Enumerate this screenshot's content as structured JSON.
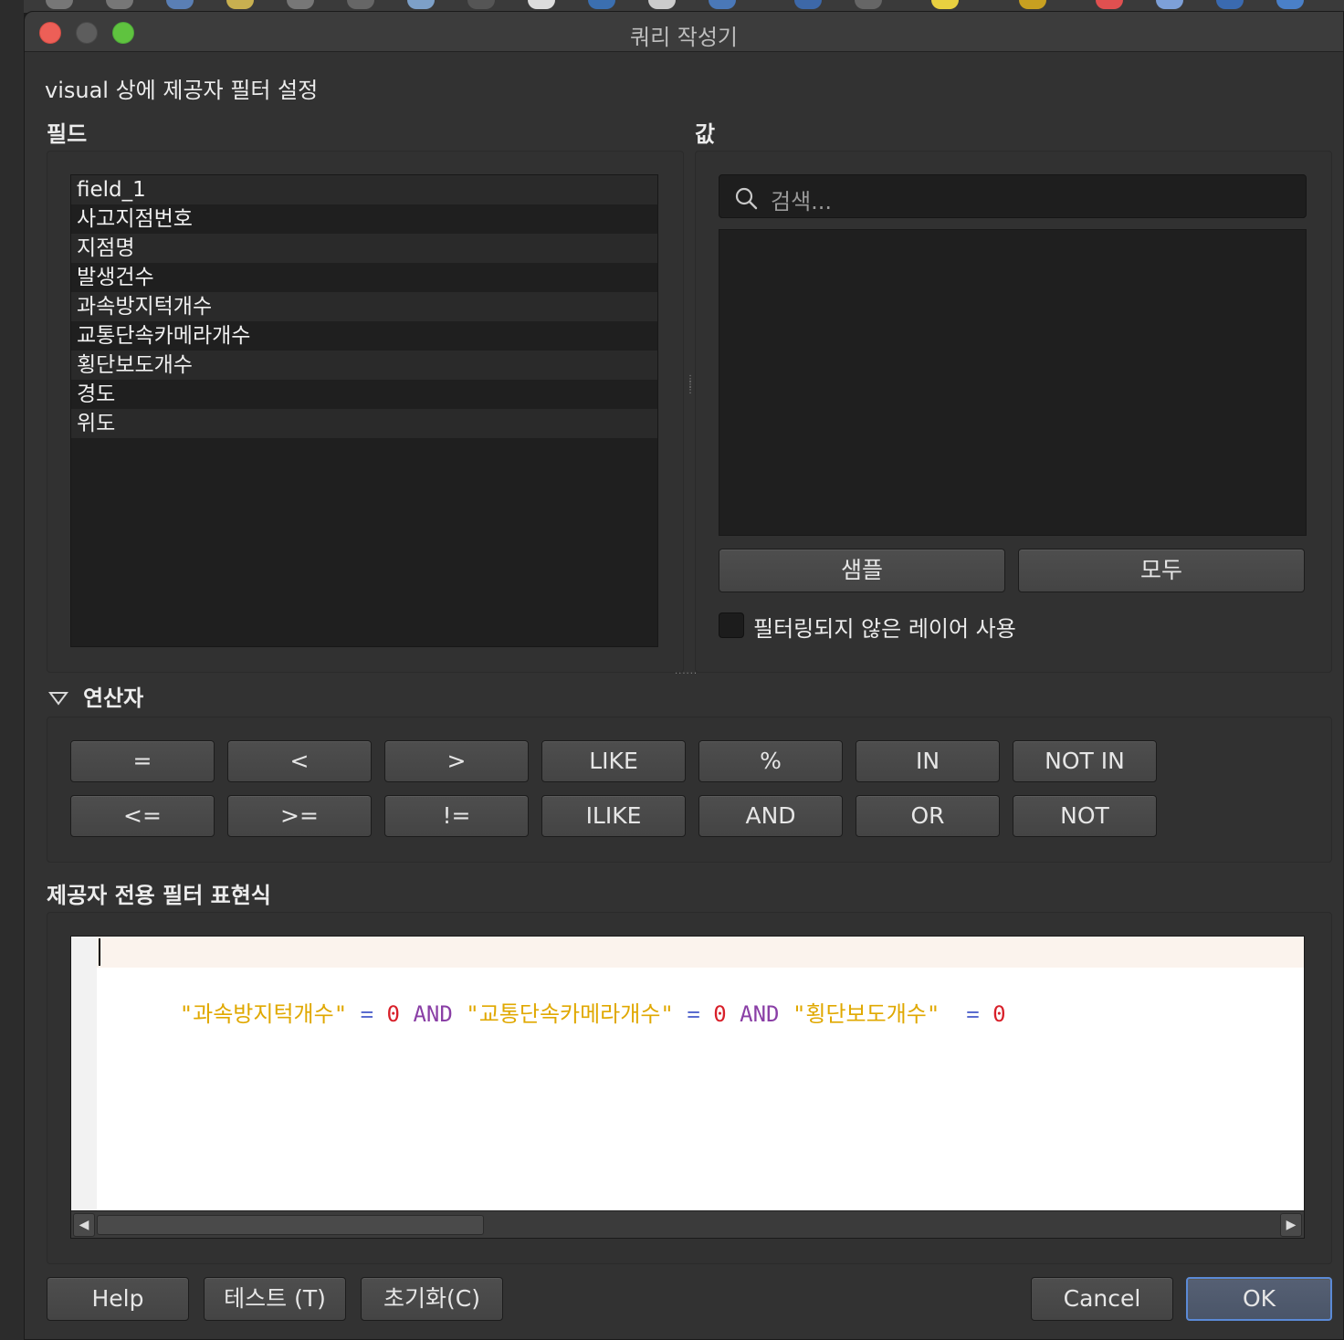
{
  "window": {
    "title": "쿼리 작성기"
  },
  "header": {
    "description": "visual 상에 제공자 필터 설정"
  },
  "fields": {
    "title": "필드",
    "items": [
      "field_1",
      "사고지점번호",
      "지점명",
      "발생건수",
      "과속방지턱개수",
      "교통단속카메라개수",
      "횡단보도개수",
      "경도",
      "위도"
    ]
  },
  "values": {
    "title": "값",
    "search_placeholder": "검색...",
    "sample_label": "샘플",
    "all_label": "모두",
    "unfiltered_label": "필터링되지 않은 레이어 사용"
  },
  "operators": {
    "title": "연산자",
    "row1": [
      "=",
      "<",
      ">",
      "LIKE",
      "%",
      "IN",
      "NOT IN"
    ],
    "row2": [
      "<=",
      ">=",
      "!=",
      "ILIKE",
      "AND",
      "OR",
      "NOT"
    ]
  },
  "expression": {
    "title": "제공자 전용 필터 표현식",
    "tokens": [
      {
        "text": "\"과속방지턱개수\"",
        "type": "str"
      },
      {
        "text": " ",
        "type": "ws"
      },
      {
        "text": "=",
        "type": "op"
      },
      {
        "text": " ",
        "type": "ws"
      },
      {
        "text": "0",
        "type": "num"
      },
      {
        "text": " ",
        "type": "ws"
      },
      {
        "text": "AND",
        "type": "kw"
      },
      {
        "text": " ",
        "type": "ws"
      },
      {
        "text": "\"교통단속카메라개수\"",
        "type": "str"
      },
      {
        "text": " ",
        "type": "ws"
      },
      {
        "text": "=",
        "type": "op"
      },
      {
        "text": " ",
        "type": "ws"
      },
      {
        "text": "0",
        "type": "num"
      },
      {
        "text": " ",
        "type": "ws"
      },
      {
        "text": "AND",
        "type": "kw"
      },
      {
        "text": " ",
        "type": "ws"
      },
      {
        "text": "\"횡단보도개수\"",
        "type": "str"
      },
      {
        "text": "  ",
        "type": "ws"
      },
      {
        "text": "=",
        "type": "op"
      },
      {
        "text": " ",
        "type": "ws"
      },
      {
        "text": "0",
        "type": "num"
      }
    ]
  },
  "footer": {
    "help_label": "Help",
    "test_label": "테스트 (T)",
    "reset_label": "초기화(C)",
    "cancel_label": "Cancel",
    "ok_label": "OK"
  },
  "colors": {
    "string": "#e0a800",
    "operator": "#5a6ccf",
    "number": "#d8202a",
    "keyword": "#8a3fa6",
    "ok_border": "#5b8ad6"
  }
}
